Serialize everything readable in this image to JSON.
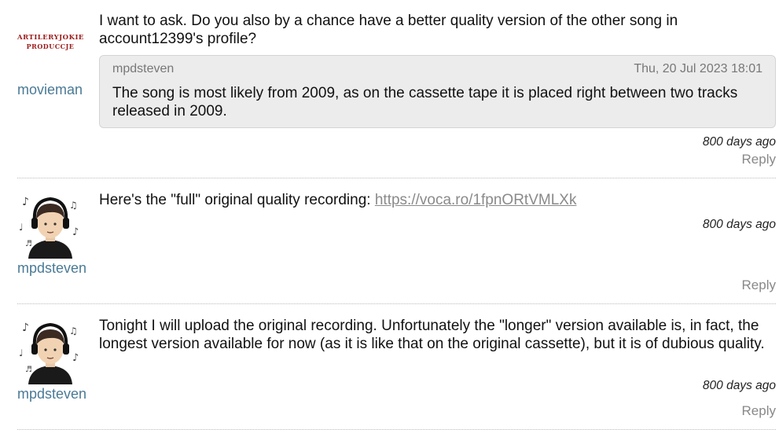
{
  "comments": [
    {
      "username": "movieman",
      "avatar": {
        "type": "logo",
        "line1": "ARTILERYJOKIE",
        "line2": "PRODUCCJE"
      },
      "text": "I want to ask. Do you also by a chance have a better quality version of the other song in account12399's profile?",
      "quote": {
        "user": "mpdsteven",
        "date": "Thu, 20 Jul 2023 18:01",
        "text": "The song is most likely from 2009, as on the cassette tape it is placed right between two tracks released in 2009."
      },
      "ago": "800 days ago",
      "reply": "Reply"
    },
    {
      "username": "mpdsteven",
      "avatar": {
        "type": "headphones-person-icon"
      },
      "text_prefix": "Here's the \"full\" original quality recording: ",
      "link": "https://voca.ro/1fpnORtVMLXk",
      "ago": "800 days ago",
      "reply": "Reply"
    },
    {
      "username": "mpdsteven",
      "avatar": {
        "type": "headphones-person-icon"
      },
      "text": "Tonight I will upload the original recording. Unfortunately the \"longer\" version available is, in fact, the longest version available for now (as it is like that on the original cassette), but it is of dubious quality.",
      "ago": "800 days ago",
      "reply": "Reply"
    }
  ],
  "colors": {
    "username": "#4a7a96",
    "link": "#8a8a8a",
    "quote_bg": "#ececec",
    "reply": "#888888",
    "logo": "#9b1b1b"
  }
}
